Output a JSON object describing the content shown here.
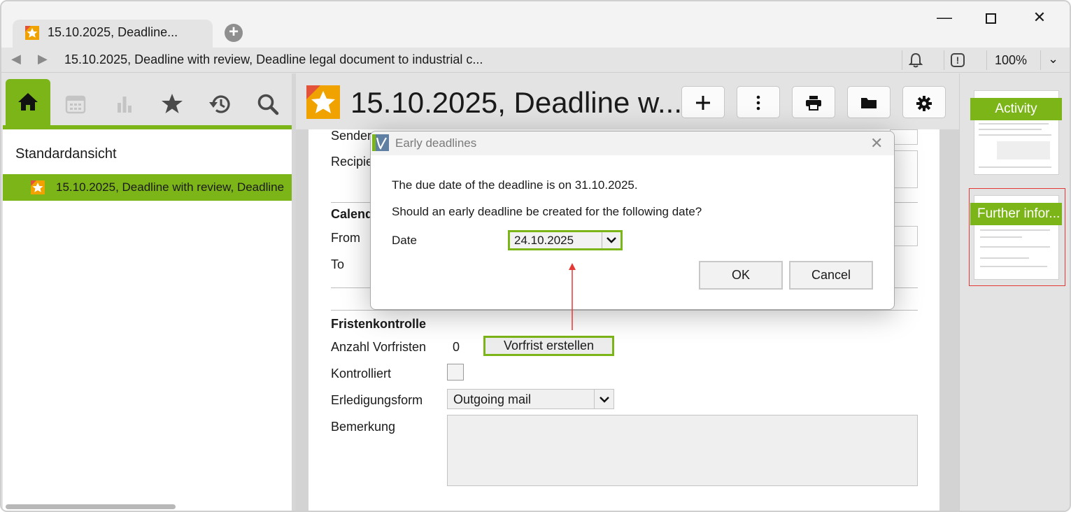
{
  "window": {
    "tab_title": "15.10.2025, Deadline...",
    "address": "15.10.2025, Deadline with review, Deadline legal document to industrial c...",
    "zoom": "100%"
  },
  "left_panel": {
    "view_title": "Standardansicht",
    "tree_item": "15.10.2025, Deadline with review, Deadline",
    "tabs": [
      "home-icon",
      "calendar-icon",
      "chart-icon",
      "star-icon",
      "history-icon",
      "search-icon"
    ]
  },
  "document": {
    "title": "15.10.2025, Deadline w...",
    "toolbar": [
      "add-icon",
      "more-icon",
      "print-icon",
      "folder-icon",
      "settings-icon"
    ]
  },
  "form": {
    "sender_label": "Sender",
    "recipient_label": "Recipie",
    "calendar_heading": "Calend",
    "from_label": "From",
    "to_label": "To",
    "section_heading": "Fristenkontrolle",
    "count_label": "Anzahl Vorfristen",
    "count_value": "0",
    "create_button": "Vorfrist erstellen",
    "checked_label": "Kontrolliert",
    "completion_label": "Erledigungsform",
    "completion_value": "Outgoing mail",
    "remark_label": "Bemerkung"
  },
  "right_panel": {
    "thumb1_label": "Activity",
    "thumb2_label": "Further infor..."
  },
  "dialog": {
    "title": "Early deadlines",
    "line1": "The due date of the deadline is on 31.10.2025.",
    "line2": "Should an early deadline be created for the following date?",
    "date_label": "Date",
    "date_value": "24.10.2025",
    "ok": "OK",
    "cancel": "Cancel"
  },
  "colors": {
    "accent": "#7cb518",
    "selection": "#e53935",
    "arrow": "#e53935"
  }
}
